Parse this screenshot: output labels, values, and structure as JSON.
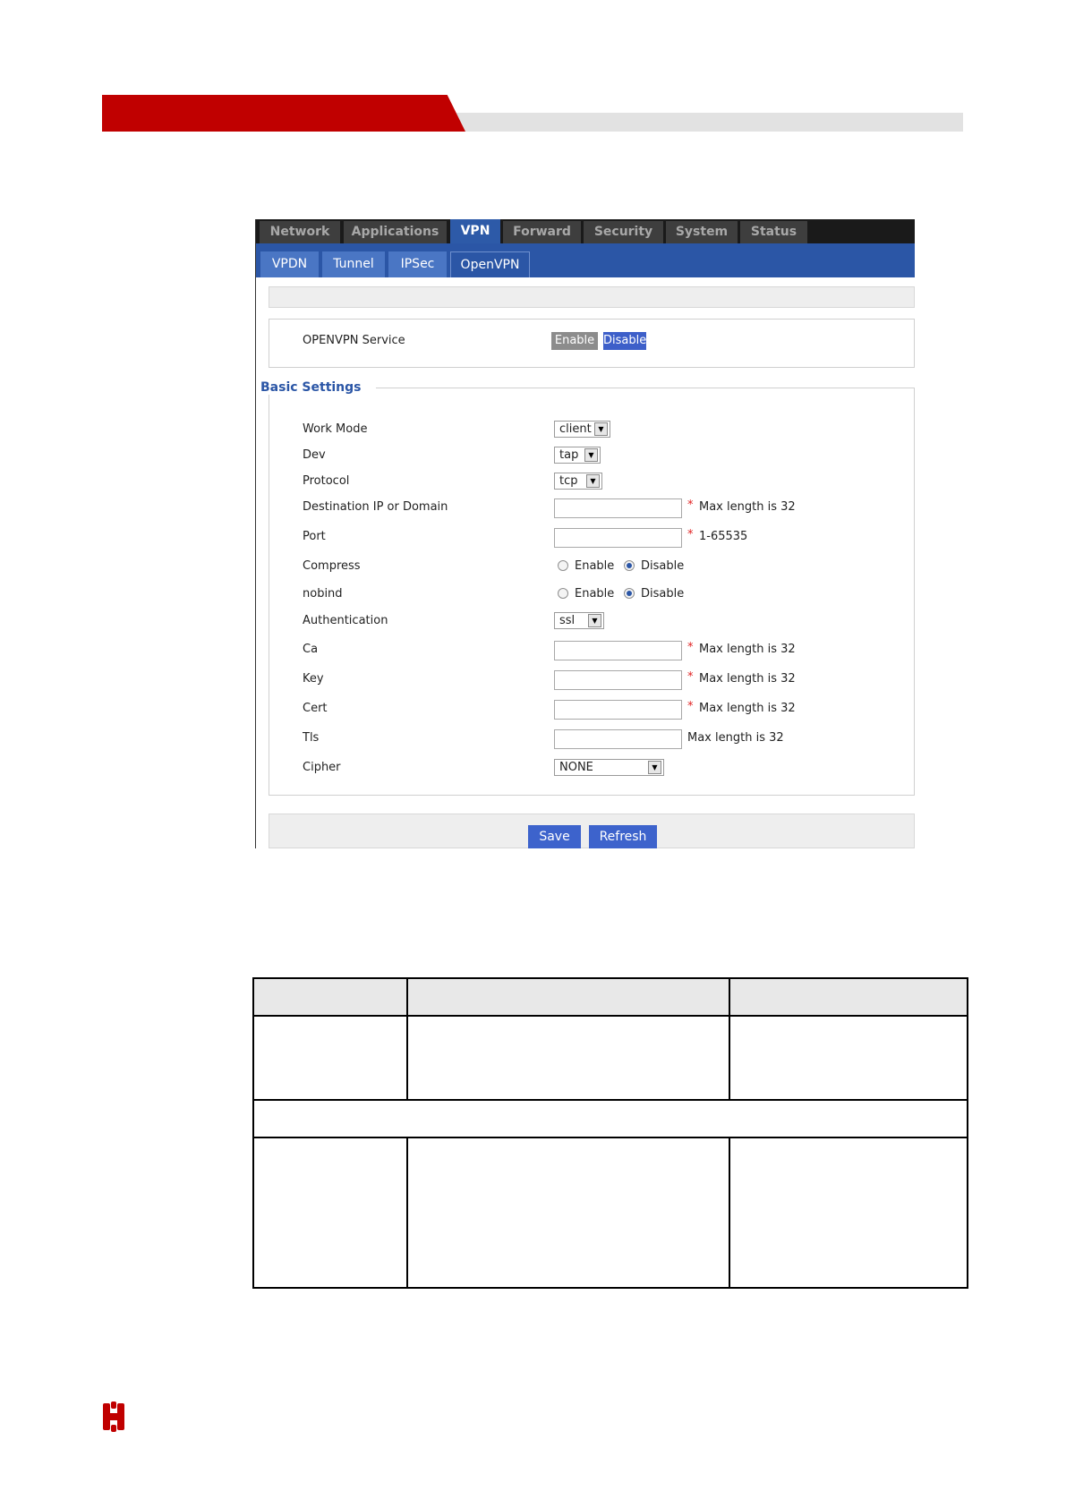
{
  "colors": {
    "brand_red": "#c00000",
    "nav_blue": "#2b56a6",
    "button_blue": "#3d63cc"
  },
  "top_nav": [
    {
      "label": "Network",
      "active": false
    },
    {
      "label": "Applications",
      "active": false
    },
    {
      "label": "VPN",
      "active": true
    },
    {
      "label": "Forward",
      "active": false
    },
    {
      "label": "Security",
      "active": false
    },
    {
      "label": "System",
      "active": false
    },
    {
      "label": "Status",
      "active": false
    }
  ],
  "sub_nav": [
    {
      "label": "VPDN",
      "active": false
    },
    {
      "label": "Tunnel",
      "active": false
    },
    {
      "label": "IPSec",
      "active": false
    },
    {
      "label": "OpenVPN",
      "active": true
    }
  ],
  "service": {
    "label": "OPENVPN Service",
    "enable_label": "Enable",
    "disable_label": "Disable",
    "selected": "Disable"
  },
  "basic_settings": {
    "legend": "Basic Settings",
    "work_mode": {
      "label": "Work Mode",
      "value": "client"
    },
    "dev": {
      "label": "Dev",
      "value": "tap"
    },
    "protocol": {
      "label": "Protocol",
      "value": "tcp"
    },
    "destination": {
      "label": "Destination IP or Domain",
      "value": "",
      "required": "*",
      "hint": "Max length is 32"
    },
    "port": {
      "label": "Port",
      "value": "",
      "required": "*",
      "hint": "1-65535"
    },
    "compress": {
      "label": "Compress",
      "enable": "Enable",
      "disable": "Disable",
      "selected": "Disable"
    },
    "nobind": {
      "label": "nobind",
      "enable": "Enable",
      "disable": "Disable",
      "selected": "Disable"
    },
    "authentication": {
      "label": "Authentication",
      "value": "ssl"
    },
    "ca": {
      "label": "Ca",
      "value": "",
      "required": "*",
      "hint": "Max length is 32"
    },
    "key": {
      "label": "Key",
      "value": "",
      "required": "*",
      "hint": "Max length is 32"
    },
    "cert": {
      "label": "Cert",
      "value": "",
      "required": "*",
      "hint": "Max length is 32"
    },
    "tls": {
      "label": "Tls",
      "value": "",
      "hint": "Max length is 32"
    },
    "cipher": {
      "label": "Cipher",
      "value": "NONE"
    }
  },
  "actions": {
    "save": "Save",
    "refresh": "Refresh"
  },
  "icons": {
    "select_arrow": "chevron-down-icon",
    "logo": "company-logo"
  }
}
